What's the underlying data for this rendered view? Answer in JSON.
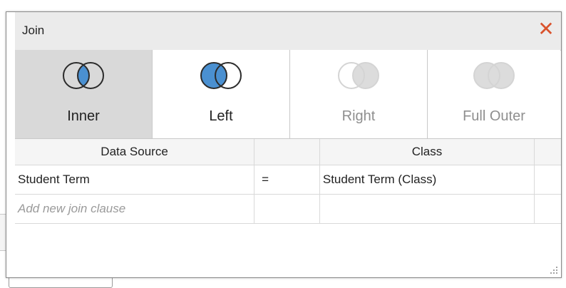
{
  "colors": {
    "selected_fill": "#4a90d1",
    "close_icon": "#d9522c",
    "selected_bg": "#d9d9d9",
    "disabled": "#bdbdbd"
  },
  "dialog": {
    "title": "Join",
    "close_icon": "close-icon",
    "join_types": [
      {
        "label": "Inner",
        "icon": "inner-join-icon",
        "selected": true,
        "enabled": true
      },
      {
        "label": "Left",
        "icon": "left-join-icon",
        "selected": false,
        "enabled": true
      },
      {
        "label": "Right",
        "icon": "right-join-icon",
        "selected": false,
        "enabled": false
      },
      {
        "label": "Full Outer",
        "icon": "full-outer-join-icon",
        "selected": false,
        "enabled": false
      }
    ],
    "grid": {
      "headers": [
        "Data Source",
        "",
        "Class",
        ""
      ],
      "rows": [
        {
          "left": "Student Term",
          "operator": "=",
          "right": "Student Term (Class)"
        }
      ],
      "add_placeholder": "Add new join clause"
    }
  }
}
